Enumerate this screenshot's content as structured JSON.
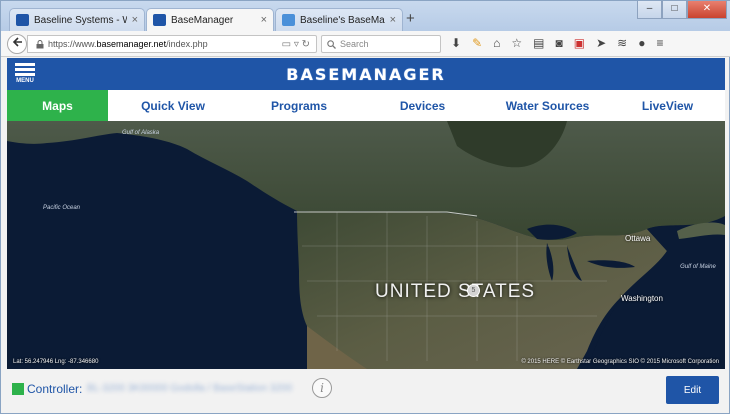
{
  "browser": {
    "tabs": [
      {
        "label": "Baseline Systems - World L...",
        "favicon_color": "#1f55a7"
      },
      {
        "label": "BaseManager",
        "favicon_color": "#1f55a7"
      },
      {
        "label": "Baseline's BaseManager He...",
        "favicon_color": "#4a90d9"
      }
    ],
    "new_tab_glyph": "+",
    "tab_close_glyph": "×",
    "window_controls": {
      "minimize": "–",
      "maximize": "□",
      "close": "✕"
    },
    "url": {
      "prefix": "https://www.",
      "host": "basemanager.net",
      "path": "/index.php"
    },
    "search_placeholder": "Search",
    "toolbar_icons": [
      "download-icon",
      "pencil-icon",
      "home-icon",
      "star-icon",
      "reading-list-icon",
      "pocket-icon",
      "pdf-icon",
      "send-icon",
      "wifi-icon",
      "chat-icon",
      "hamburger-menu-icon"
    ]
  },
  "app": {
    "menu_label": "MENU",
    "brand": "BASEMANAGER",
    "nav_tabs": [
      {
        "label": "Maps",
        "selected": true
      },
      {
        "label": "Quick View",
        "selected": false
      },
      {
        "label": "Programs",
        "selected": false
      },
      {
        "label": "Devices",
        "selected": false
      },
      {
        "label": "Water Sources",
        "selected": false
      },
      {
        "label": "LiveView",
        "selected": false
      }
    ],
    "map": {
      "center_label": "UNITED STATES",
      "pin_label": "5",
      "oceans": {
        "gulf_alaska": "Gulf of Alaska",
        "pacific": "Pacific Ocean",
        "gulf_maine": "Gulf of Maine"
      },
      "cities": {
        "ottawa": "Ottawa",
        "washington": "Washington"
      },
      "coords": "Lat: 56.247946 Lng: -87.346680",
      "credits": "© 2015 HERE   © Earthstar Geographics SIO   © 2015 Microsoft Corporation"
    },
    "footer": {
      "controller_label": "Controller:",
      "controller_value": "BL-3200 3K00000 Godolla / BaseStation 3200",
      "info_glyph": "i",
      "edit_label": "Edit"
    },
    "colors": {
      "brand_blue": "#1f55a7",
      "selected_green": "#2eb24b"
    }
  }
}
